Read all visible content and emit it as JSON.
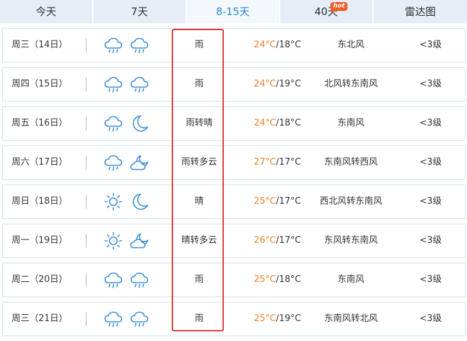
{
  "tabs": [
    {
      "label": "今天",
      "active": false
    },
    {
      "label": "7天",
      "active": false
    },
    {
      "label": "8-15天",
      "active": true
    },
    {
      "label": "40天",
      "active": false,
      "badge": "hot"
    },
    {
      "label": "雷达图",
      "active": false
    }
  ],
  "colors": {
    "accent": "#2a86d6",
    "high_temp": "#f17e2d",
    "highlight_box": "#e53935",
    "tab_bg": "#e5eef7",
    "badge": "#f25e2a"
  },
  "forecast": [
    {
      "date": "周三（14日）",
      "icon_day": "rain-cloud-icon",
      "icon_night": "rain-cloud-icon",
      "desc": "雨",
      "high": "24°C",
      "sep": "/",
      "low": "18°C",
      "wind": "东北风",
      "level": "<3级"
    },
    {
      "date": "周四（15日）",
      "icon_day": "rain-cloud-icon",
      "icon_night": "rain-cloud-icon",
      "desc": "雨",
      "high": "24°C",
      "sep": "/",
      "low": "19°C",
      "wind": "北风转东南风",
      "level": "<3级"
    },
    {
      "date": "周五（16日）",
      "icon_day": "rain-cloud-icon",
      "icon_night": "moon-icon",
      "desc": "雨转晴",
      "high": "24°C",
      "sep": "/",
      "low": "18°C",
      "wind": "东南风",
      "level": "<3级"
    },
    {
      "date": "周六（17日）",
      "icon_day": "rain-cloud-icon",
      "icon_night": "cloud-moon-icon",
      "desc": "雨转多云",
      "high": "27°C",
      "sep": "/",
      "low": "17°C",
      "wind": "东南风转西风",
      "level": "<3级"
    },
    {
      "date": "周日（18日）",
      "icon_day": "sun-icon",
      "icon_night": "moon-icon",
      "desc": "晴",
      "high": "25°C",
      "sep": "/",
      "low": "17°C",
      "wind": "西北风转东南风",
      "level": "<3级"
    },
    {
      "date": "周一（19日）",
      "icon_day": "sun-icon",
      "icon_night": "cloud-moon-icon",
      "desc": "晴转多云",
      "high": "26°C",
      "sep": "/",
      "low": "17°C",
      "wind": "东风转东南风",
      "level": "<3级"
    },
    {
      "date": "周二（20日）",
      "icon_day": "rain-cloud-icon",
      "icon_night": "rain-cloud-icon",
      "desc": "雨",
      "high": "25°C",
      "sep": "/",
      "low": "18°C",
      "wind": "东南风",
      "level": "<3级"
    },
    {
      "date": "周三（21日）",
      "icon_day": "rain-cloud-icon",
      "icon_night": "rain-cloud-icon",
      "desc": "雨",
      "high": "25°C",
      "sep": "/",
      "low": "19°C",
      "wind": "东南风转北风",
      "level": "<3级"
    }
  ]
}
